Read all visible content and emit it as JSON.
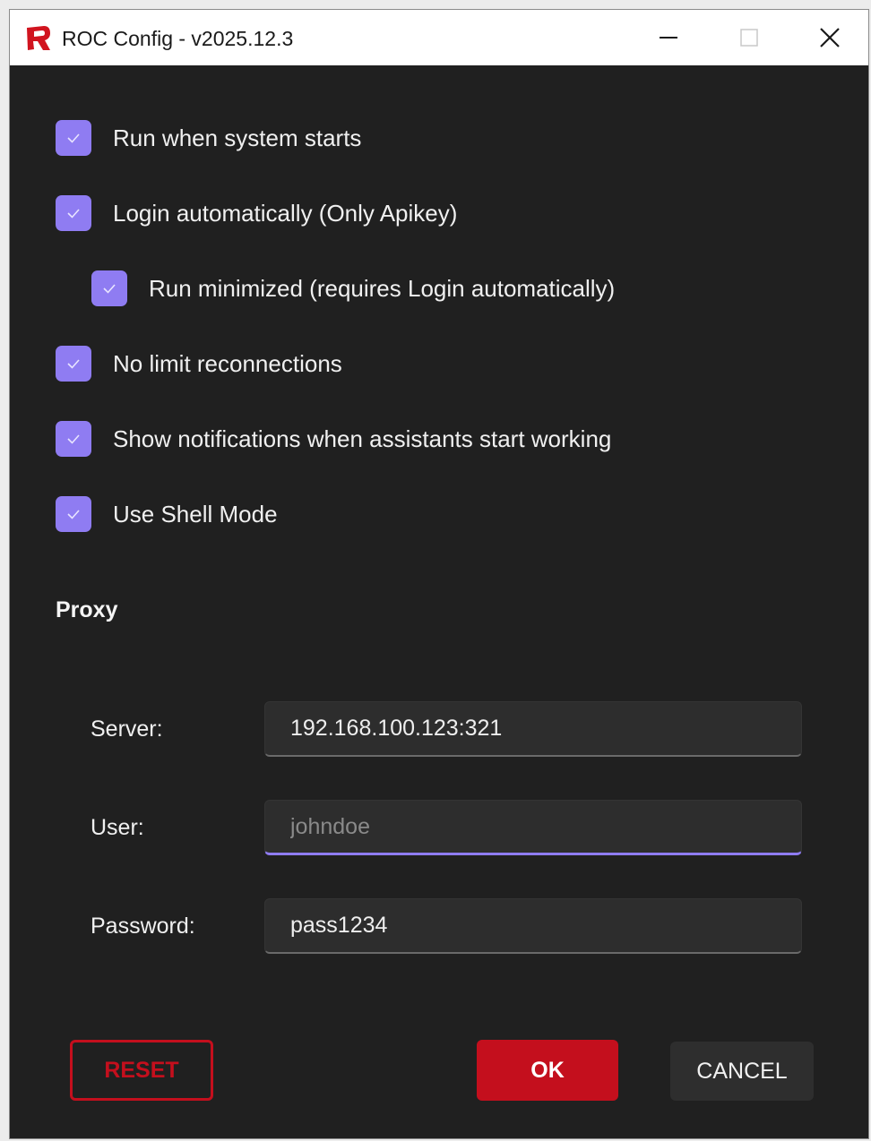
{
  "window": {
    "title": "ROC Config - v2025.12.3",
    "logo_icon": "roc-logo-icon",
    "controls": {
      "minimize_icon": "minimize-icon",
      "maximize_icon": "maximize-icon",
      "close_icon": "close-icon"
    }
  },
  "options": [
    {
      "label": "Run when system starts",
      "checked": true
    },
    {
      "label": "Login automatically (Only Apikey)",
      "checked": true
    },
    {
      "label": "Run minimized (requires Login automatically)",
      "checked": true
    },
    {
      "label": "No limit reconnections",
      "checked": true
    },
    {
      "label": "Show notifications when assistants start working",
      "checked": true
    },
    {
      "label": "Use Shell Mode",
      "checked": true
    }
  ],
  "proxy": {
    "title": "Proxy",
    "server_label": "Server:",
    "server_value": "192.168.100.123:321",
    "user_label": "User:",
    "user_value": "",
    "user_placeholder": "johndoe",
    "password_label": "Password:",
    "password_value": "pass1234"
  },
  "buttons": {
    "reset": "RESET",
    "ok": "OK",
    "cancel": "CANCEL"
  },
  "colors": {
    "accent": "#8f7cf2",
    "danger": "#c40f1d",
    "background": "#202020",
    "input_background": "#2d2d2d"
  }
}
